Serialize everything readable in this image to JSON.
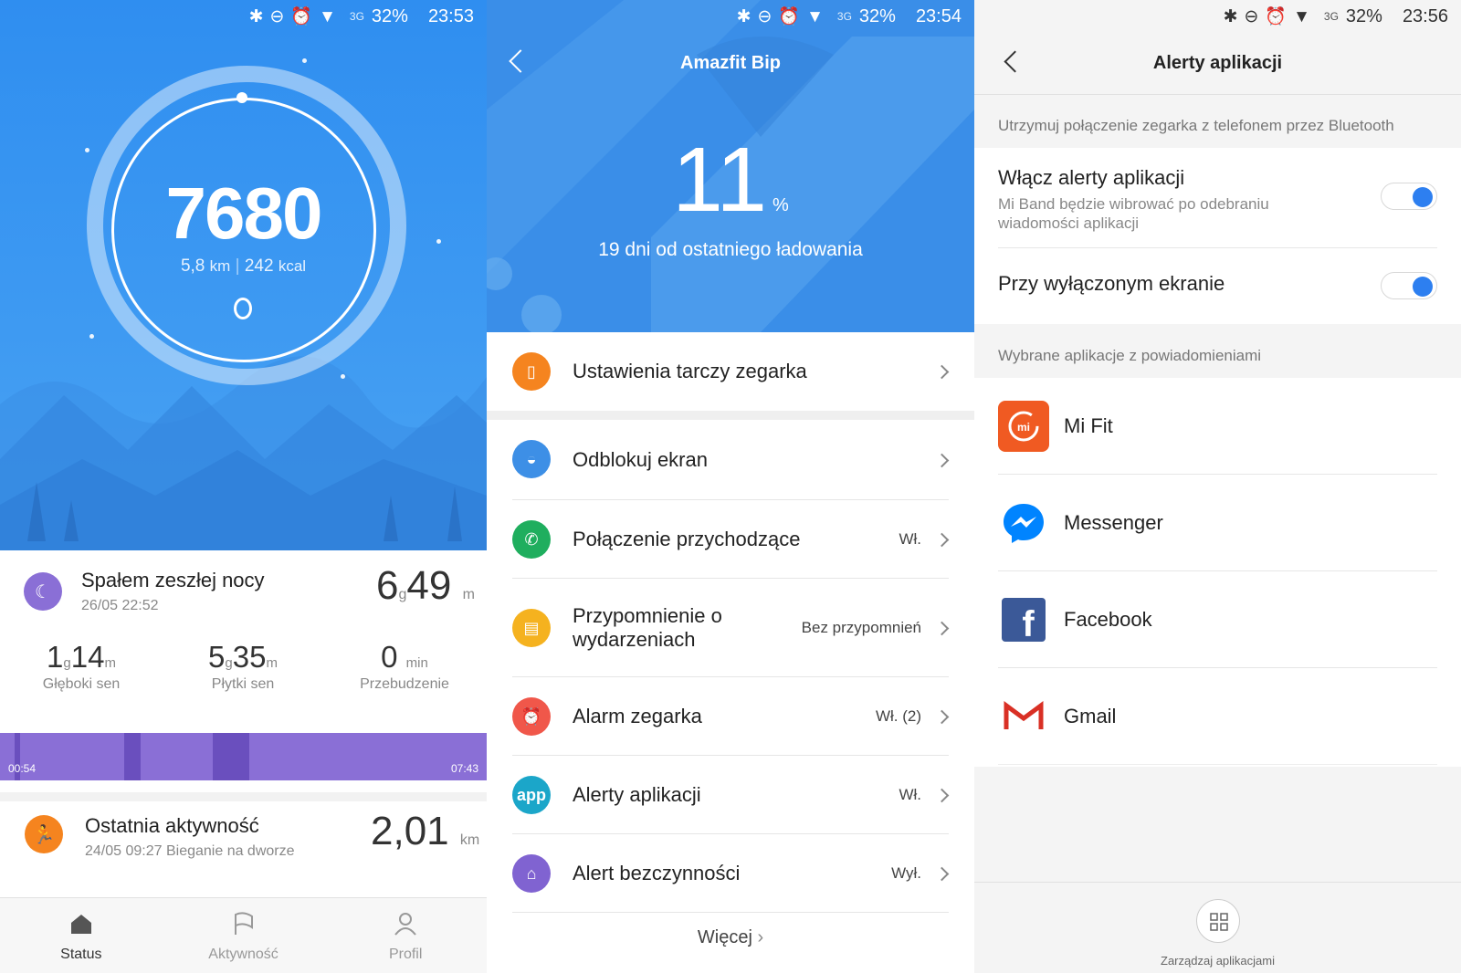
{
  "status_bars": [
    {
      "time": "23:53",
      "battery": "32%",
      "network": "3G",
      "icons": "bluetooth-icon dnd-icon alarm-icon wifi-icon signal-icon"
    },
    {
      "time": "23:54",
      "battery": "32%",
      "network": "3G",
      "icons": "bluetooth-icon dnd-icon alarm-icon wifi-icon signal-icon"
    },
    {
      "time": "23:56",
      "battery": "32%",
      "network": "3G",
      "icons": "bluetooth-icon dnd-icon alarm-icon wifi-icon signal-icon"
    }
  ],
  "status_screen": {
    "steps": "7680",
    "distance": "5,8",
    "distance_unit": "km",
    "calories": "242",
    "calories_unit": "kcal",
    "sleep": {
      "title": "Spałem zeszłej nocy",
      "date": "26/05 22:52",
      "hours": "6",
      "hours_unit": "g",
      "minutes": "49",
      "minutes_unit": "m",
      "deep_h": "1",
      "deep_m": "14",
      "deep_label": "Głęboki sen",
      "light_h": "5",
      "light_m": "35",
      "light_label": "Płytki sen",
      "awake_value": "0",
      "awake_unit": "min",
      "awake_label": "Przebudzenie",
      "bar_start": "00:54",
      "bar_end": "07:43"
    },
    "activity": {
      "title": "Ostatnia aktywność",
      "detail": "24/05 09:27 Bieganie na dworze",
      "value": "2,01",
      "unit": "km"
    },
    "nav": [
      {
        "label": "Status",
        "icon": "home-icon"
      },
      {
        "label": "Aktywność",
        "icon": "flag-icon"
      },
      {
        "label": "Profil",
        "icon": "person-icon"
      }
    ]
  },
  "device_screen": {
    "title": "Amazfit Bip",
    "battery_value": "11",
    "battery_unit": "%",
    "battery_sub": "19 dni od ostatniego ładowania",
    "items": [
      {
        "label": "Ustawienia tarczy zegarka",
        "value": "",
        "color": "#f5841f",
        "icon": "watch-face-icon"
      },
      {
        "label": "Odblokuj ekran",
        "value": "",
        "color": "#3d8fe6",
        "icon": "unlock-icon"
      },
      {
        "label": "Połączenie przychodzące",
        "value": "Wł.",
        "color": "#1fae5e",
        "icon": "phone-icon"
      },
      {
        "label": "Przypomnienie o wydarzeniach",
        "value": "Bez przypomnień",
        "color": "#f5b21f",
        "icon": "calendar-icon"
      },
      {
        "label": "Alarm zegarka",
        "value": "Wł. (2)",
        "color": "#f0574a",
        "icon": "alarm-icon"
      },
      {
        "label": "Alerty aplikacji",
        "value": "Wł.",
        "color": "#1ba6c9",
        "icon": "app-icon",
        "icon_text": "app"
      },
      {
        "label": "Alert bezczynności",
        "value": "Wył.",
        "color": "#8063d1",
        "icon": "sofa-icon"
      }
    ],
    "more": "Więcej"
  },
  "alerts_screen": {
    "title": "Alerty aplikacji",
    "bluetooth_note": "Utrzymuj połączenie zegarka z telefonem przez Bluetooth",
    "toggle1_title": "Włącz alerty aplikacji",
    "toggle1_desc_1": "Mi Band będzie wibrować po odebraniu",
    "toggle1_desc_2": "wiadomości aplikacji",
    "toggle1_on": true,
    "toggle2_title": "Przy wyłączonym ekranie",
    "toggle2_on": true,
    "apps_label": "Wybrane aplikacje z powiadomieniami",
    "apps": [
      {
        "name": "Mi Fit",
        "icon": "mi-fit-icon",
        "color": "#f05a22"
      },
      {
        "name": "Messenger",
        "icon": "messenger-icon",
        "color": "#0084ff"
      },
      {
        "name": "Facebook",
        "icon": "facebook-icon",
        "color": "#3b5998"
      },
      {
        "name": "Gmail",
        "icon": "gmail-icon",
        "color": "#d93025"
      }
    ],
    "manage_label": "Zarządzaj aplikacjami"
  }
}
